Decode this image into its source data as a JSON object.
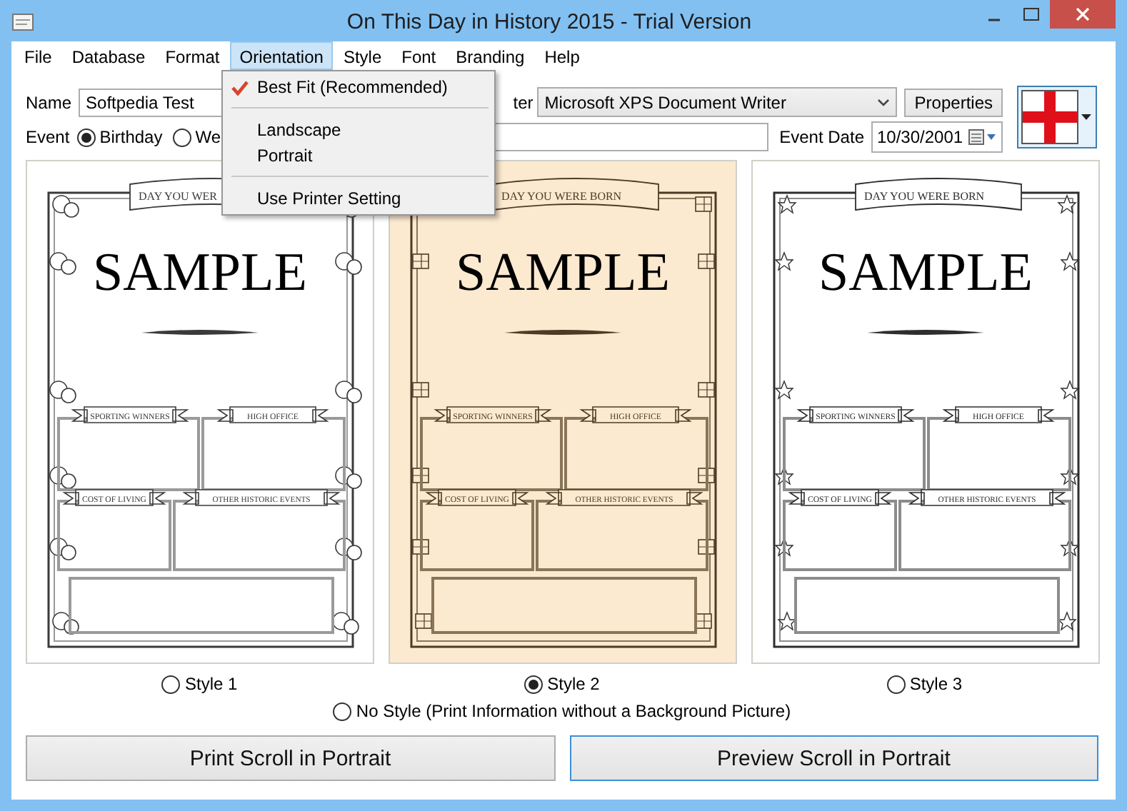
{
  "window": {
    "title": "On This Day in History 2015 - Trial Version"
  },
  "menu": [
    {
      "label": "File",
      "selected": false
    },
    {
      "label": "Database",
      "selected": false
    },
    {
      "label": "Format",
      "selected": false
    },
    {
      "label": "Orientation",
      "selected": true
    },
    {
      "label": "Style",
      "selected": false
    },
    {
      "label": "Font",
      "selected": false
    },
    {
      "label": "Branding",
      "selected": false
    },
    {
      "label": "Help",
      "selected": false
    }
  ],
  "orientation_menu": {
    "items": [
      {
        "kind": "item",
        "label": "Best Fit (Recommended)",
        "checked": true
      },
      {
        "kind": "separator"
      },
      {
        "kind": "item",
        "label": "Landscape",
        "checked": false
      },
      {
        "kind": "item",
        "label": "Portrait",
        "checked": false
      },
      {
        "kind": "separator"
      },
      {
        "kind": "item",
        "label": "Use Printer Setting",
        "checked": false
      }
    ]
  },
  "form": {
    "name_label": "Name",
    "name_value": "Softpedia Test",
    "printer_label": "ter",
    "printer_value": "Microsoft XPS Document Writer",
    "properties_button": "Properties",
    "event_label": "Event",
    "event_options": [
      {
        "label": "Birthday",
        "selected": true
      },
      {
        "label": "We",
        "selected": false
      }
    ],
    "event_date_label": "Event Date",
    "event_date_value": "10/30/2001"
  },
  "styles": [
    {
      "label": "Style 1",
      "selected": false,
      "kind": "balloons",
      "scroll": {
        "title": "DAY YOU WER",
        "sample": "SAMPLE",
        "sections": [
          "SPORTING WINNERS",
          "HIGH OFFICE",
          "COST OF LIVING",
          "OTHER HISTORIC EVENTS"
        ]
      }
    },
    {
      "label": "Style 2",
      "selected": true,
      "kind": "gifts",
      "scroll": {
        "title": "DAY YOU WERE BORN",
        "sample": "SAMPLE",
        "sections": [
          "SPORTING WINNERS",
          "HIGH OFFICE",
          "COST OF LIVING",
          "OTHER HISTORIC EVENTS"
        ]
      }
    },
    {
      "label": "Style 3",
      "selected": false,
      "kind": "stars",
      "scroll": {
        "title": "DAY YOU WERE BORN",
        "sample": "SAMPLE",
        "sections": [
          "SPORTING WINNERS",
          "HIGH OFFICE",
          "COST OF LIVING",
          "OTHER HISTORIC EVENTS"
        ]
      }
    }
  ],
  "no_style": {
    "label": "No Style (Print Information without a Background Picture)",
    "selected": false
  },
  "buttons": [
    {
      "label": "Print Scroll in Portrait",
      "focused": false
    },
    {
      "label": "Preview Scroll in Portrait",
      "focused": true
    }
  ]
}
